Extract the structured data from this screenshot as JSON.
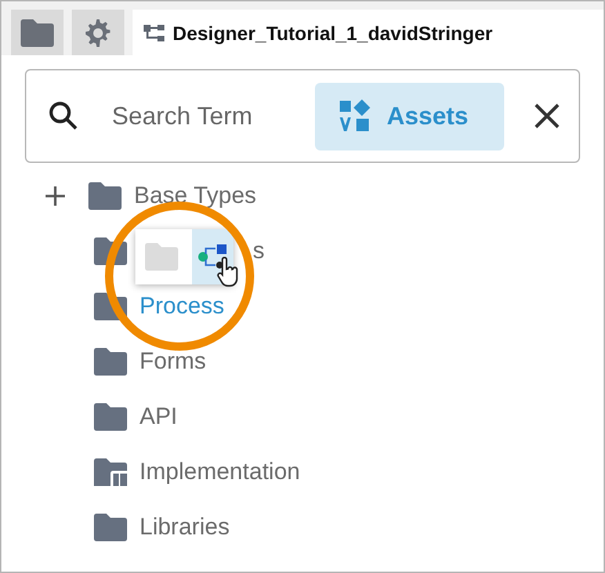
{
  "tabs": [
    {
      "kind": "folder",
      "selected": false
    },
    {
      "kind": "settings",
      "selected": false
    },
    {
      "kind": "project",
      "label": "Designer_Tutorial_1_davidStringer",
      "selected": true
    }
  ],
  "search": {
    "placeholder": "Search Term",
    "filter_button": {
      "label": "Assets",
      "selected": true
    }
  },
  "tree": [
    {
      "label": "Base Types",
      "kind": "folder",
      "expandable": true,
      "highlighted": false
    },
    {
      "label": "s",
      "kind": "folder",
      "expandable": false,
      "highlighted": false
    },
    {
      "label": "Process",
      "kind": "folder",
      "expandable": false,
      "highlighted": true
    },
    {
      "label": "Forms",
      "kind": "folder",
      "expandable": false,
      "highlighted": false
    },
    {
      "label": "API",
      "kind": "folder",
      "expandable": false,
      "highlighted": false
    },
    {
      "label": "Implementation",
      "kind": "implementation",
      "expandable": false,
      "highlighted": false
    },
    {
      "label": "Libraries",
      "kind": "folder",
      "expandable": false,
      "highlighted": false
    }
  ],
  "popup": {
    "options": [
      {
        "kind": "folder",
        "selected": false
      },
      {
        "kind": "process",
        "selected": true
      }
    ]
  }
}
